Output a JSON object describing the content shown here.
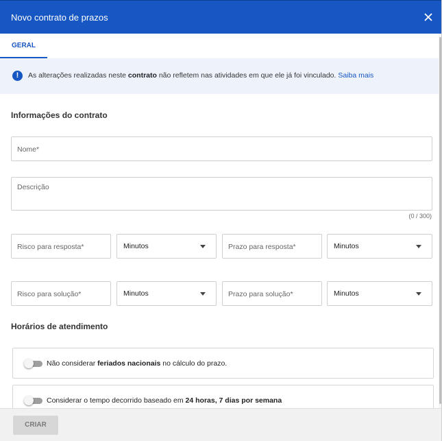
{
  "dialog": {
    "title": "Novo contrato de prazos",
    "close_icon": "close-icon"
  },
  "tabs": [
    {
      "label": "GERAL",
      "active": true
    }
  ],
  "banner": {
    "icon": "info-icon",
    "icon_glyph": "!",
    "text_before": "As alterações realizadas neste ",
    "text_bold": "contrato",
    "text_after": " não refletem nas atividades em que ele já foi vinculado. ",
    "link": "Saiba mais"
  },
  "contract_section": {
    "title": "Informações do contrato",
    "name_placeholder": "Nome*",
    "description_placeholder": "Descrição",
    "description_counter": "(0 / 300)",
    "response_risk_placeholder": "Risco para resposta*",
    "response_risk_unit": "Minutos",
    "response_deadline_placeholder": "Prazo para resposta*",
    "response_deadline_unit": "Minutos",
    "solution_risk_placeholder": "Risco para solução*",
    "solution_risk_unit": "Minutos",
    "solution_deadline_placeholder": "Prazo para solução*",
    "solution_deadline_unit": "Minutos"
  },
  "hours_section": {
    "title": "Horários de atendimento",
    "holidays_toggle": {
      "before": "Não considerar ",
      "bold": "feriados nacionais",
      "after": " no cálculo do prazo.",
      "on": false
    },
    "fulltime_toggle": {
      "before": "Considerar o tempo decorrido baseado em ",
      "bold": "24 horas, 7 dias por semana",
      "after": "",
      "on": false
    }
  },
  "footer": {
    "create_label": "CRIAR",
    "create_enabled": false
  },
  "colors": {
    "primary": "#1657c3",
    "banner_bg": "#eef3fb",
    "disabled_button": "#d7d7d7"
  }
}
